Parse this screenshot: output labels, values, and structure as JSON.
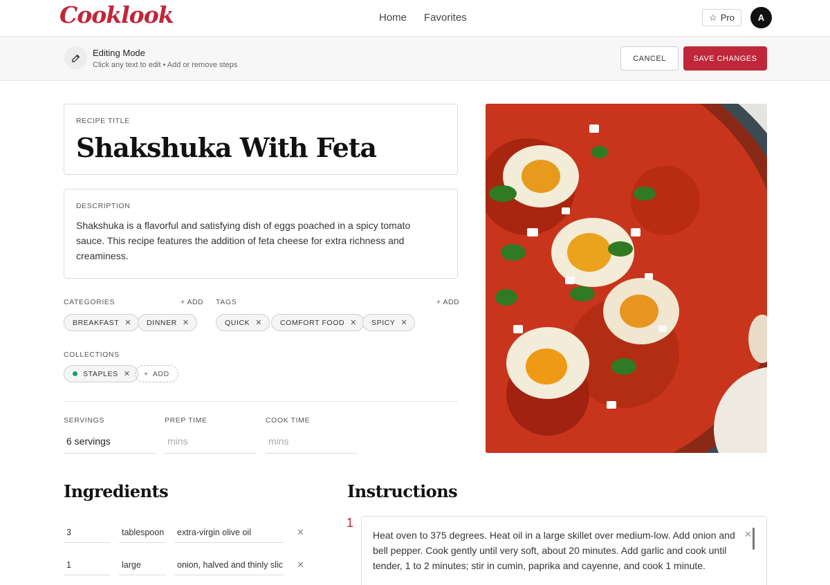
{
  "app": {
    "logo": "Cooklook",
    "nav": {
      "home": "Home",
      "favorites": "Favorites"
    },
    "pro_label": "Pro",
    "avatar_initial": "A"
  },
  "edit_bar": {
    "title": "Editing Mode",
    "subtitle": "Click any text to edit • Add or remove steps",
    "cancel_label": "CANCEL",
    "save_label": "SAVE CHANGES"
  },
  "recipe": {
    "title_label": "RECIPE TITLE",
    "title": "Shakshuka With Feta",
    "description_label": "DESCRIPTION",
    "description": "Shakshuka is a flavorful and satisfying dish of eggs poached in a spicy tomato sauce. This recipe features the addition of feta cheese for extra richness and creaminess."
  },
  "categories": {
    "label": "CATEGORIES",
    "add_label": "+ ADD",
    "items": [
      "BREAKFAST",
      "DINNER"
    ]
  },
  "tags": {
    "label": "TAGS",
    "add_label": "+ ADD",
    "items": [
      "QUICK",
      "COMFORT FOOD",
      "SPICY"
    ]
  },
  "collections": {
    "label": "COLLECTIONS",
    "items": [
      "STAPLES"
    ],
    "add_label": "ADD"
  },
  "meta": {
    "servings_label": "SERVINGS",
    "servings_value": "6 servings",
    "prep_label": "PREP TIME",
    "prep_placeholder": "mins",
    "cook_label": "COOK TIME",
    "cook_placeholder": "mins"
  },
  "ingredients": {
    "heading": "Ingredients",
    "rows": [
      {
        "qty": "3",
        "unit": "tablespoon",
        "name": "extra-virgin olive oil"
      },
      {
        "qty": "1",
        "unit": "large",
        "name": "onion, halved and thinly slic"
      }
    ]
  },
  "instructions": {
    "heading": "Instructions",
    "steps": [
      {
        "number": "1",
        "text": "Heat oven to 375 degrees. Heat oil in a large skillet over medium-low. Add onion and bell pepper. Cook gently until very soft, about 20 minutes. Add garlic and cook until tender, 1 to 2 minutes; stir in cumin, paprika and cayenne, and cook 1 minute."
      }
    ]
  },
  "colors": {
    "accent": "#c0273a",
    "collection_dot": "#1aa06a"
  }
}
